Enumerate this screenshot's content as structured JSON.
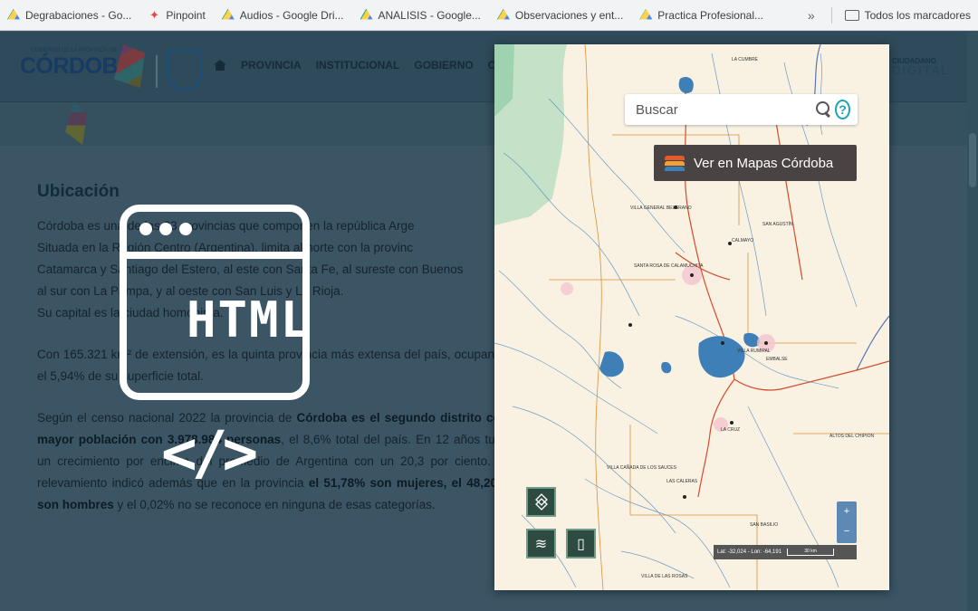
{
  "bookmarks": {
    "items": [
      {
        "label": "Degrabaciones - Go...",
        "icon": "google-drive-icon"
      },
      {
        "label": "Pinpoint",
        "icon": "pinpoint-icon"
      },
      {
        "label": "Audios - Google Dri...",
        "icon": "google-drive-icon"
      },
      {
        "label": "ANALISIS - Google...",
        "icon": "google-drive-icon"
      },
      {
        "label": "Observaciones y ent...",
        "icon": "google-drive-icon"
      },
      {
        "label": "Practica Profesional...",
        "icon": "google-drive-icon"
      }
    ],
    "more": "»",
    "all_bookmarks": "Todos los marcadores"
  },
  "header": {
    "logo_text": "CÓRDOBA",
    "logo_subtext": "GOBIERNO DE LA PROVINCIA DE",
    "nav": [
      "PROVINCIA",
      "INSTITUCIONAL",
      "GOBIERNO",
      "CI"
    ],
    "ciudadano_top": "CIUDADANO",
    "ciudadano_bottom": "DIGITAL"
  },
  "article": {
    "title": "Ubicación",
    "p1_lines": [
      "Córdoba es una de las 23 provincias que componen la república Arge",
      "Situada en la Región Centro (Argentina), limita al norte con la provinc",
      "Catamarca y Santiago del Estero, al este con Santa Fe, al sureste con Buenos",
      "al sur con La Pampa, y al oeste con San Luis y La Rioja.",
      "Su capital es la ciudad homónima."
    ],
    "p2": "Con 165.321 km² de extensión, es la quinta provincia más extensa del país, ocupando el 5,94% de su superficie total.",
    "p3_a": "Según el censo nacional 2022 la provincia de ",
    "p3_b": "Córdoba es el segundo distrito con mayor población con 3.978.984 personas",
    "p3_c": ", el 8,6% total del país. En 12 años tuvo un crecimiento por encima del promedio de Argentina con un 20,3 por ciento. El relevamiento indicó además que en la provincia ",
    "p3_d": "el 51,78% son mujeres, el 48,20% son hombres",
    "p3_e": " y el 0,02% no se reconoce en ninguna de esas categorías."
  },
  "overlay": {
    "badge_text": "HTML",
    "code_text": "</>"
  },
  "map": {
    "search_placeholder": "Buscar",
    "help_symbol": "?",
    "ver_mapas_label": "Ver en Mapas Córdoba",
    "zoom_in": "+",
    "zoom_out": "−",
    "coords_text": "Lat: -32,024 - Lon: -64,191",
    "scale_text": "30 km",
    "places": [
      "LA CUMBRE",
      "VILLA GENERAL BELGRANO",
      "SAN AGUSTÍN",
      "CALMAYO",
      "VILLA RUMIPAL",
      "EMBALSE",
      "LA CRUZ",
      "LAS CALERAS",
      "VILLA CAÑADA DE LOS SAUCES",
      "VILLA DE LAS ROSAS",
      "SANTA ROSA DE CALAMUCHITA",
      "ALTOS DEL CHIPION",
      "SAN BASILIO"
    ],
    "colors": {
      "water": "#3d7fb6",
      "road": "#d44b2a",
      "boundary": "#d9903a",
      "bg": "#f9f2e3",
      "green": "#b8dcbf"
    }
  }
}
